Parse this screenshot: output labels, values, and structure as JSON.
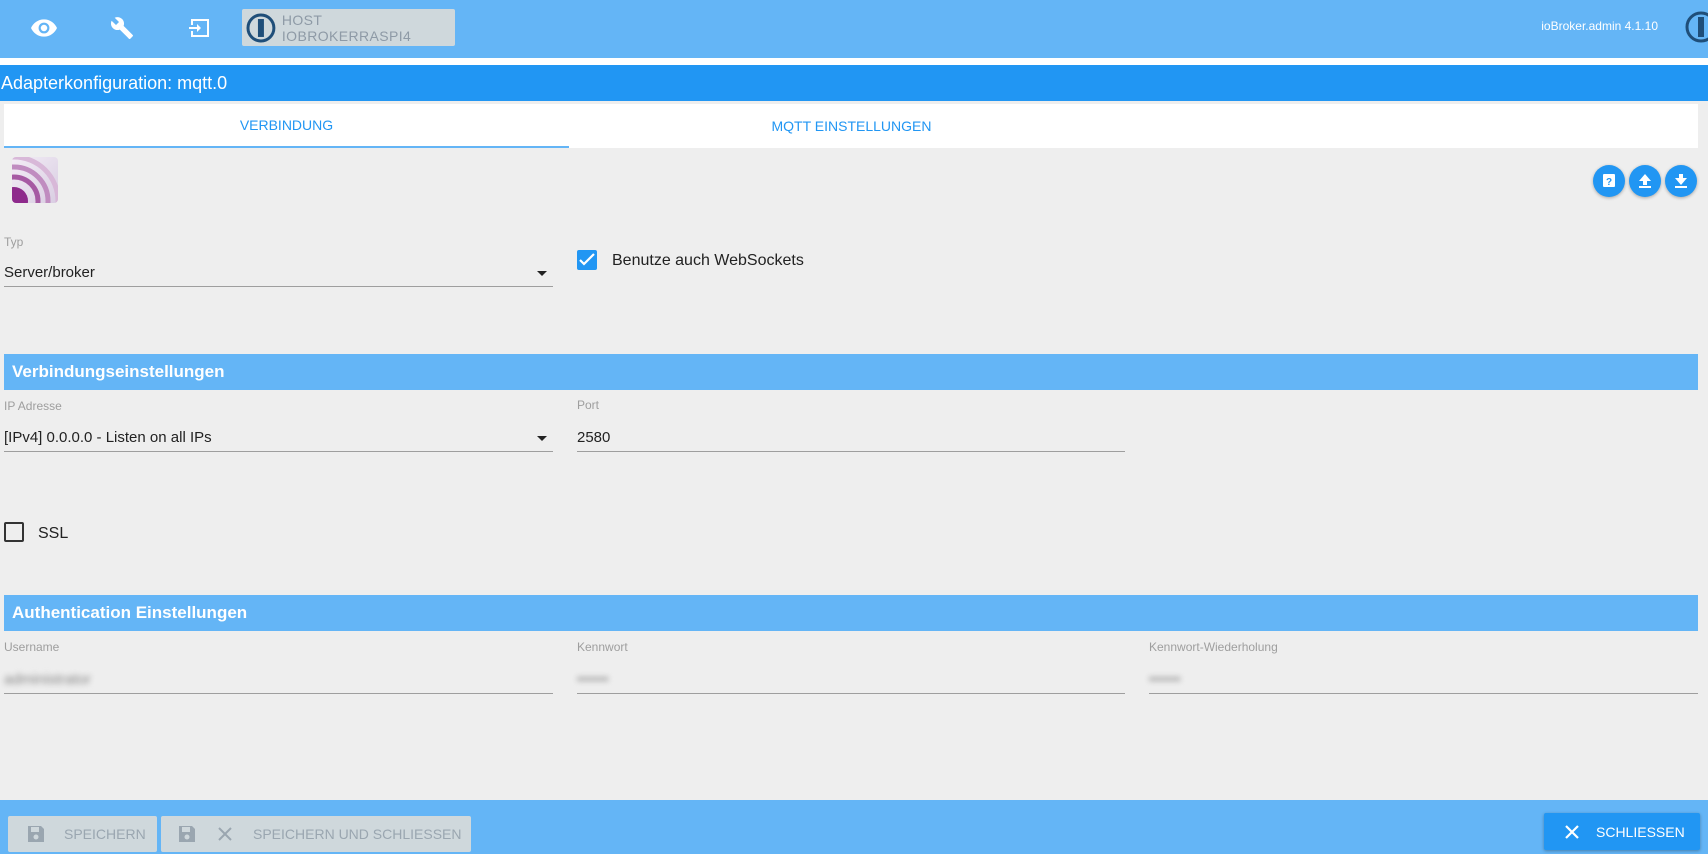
{
  "topbar": {
    "icons": [
      "eye-icon",
      "wrench-icon",
      "logout-icon"
    ],
    "host_label": "HOST IOBROKERRASPI4",
    "version": "ioBroker.admin 4.1.10"
  },
  "title": "Adapterkonfiguration: mqtt.0",
  "tabs": [
    {
      "label": "VERBINDUNG",
      "active": true
    },
    {
      "label": "MQTT EINSTELLUNGEN",
      "active": false
    }
  ],
  "form": {
    "typ_label": "Typ",
    "typ_value": "Server/broker",
    "websockets_label": "Benutze auch WebSockets",
    "websockets_checked": true
  },
  "sections": {
    "connection": "Verbindungseinstellungen",
    "auth": "Authentication Einstellungen"
  },
  "connection": {
    "ip_label": "IP Adresse",
    "ip_value": "[IPv4] 0.0.0.0 - Listen on all IPs",
    "port_label": "Port",
    "port_value": "2580",
    "ssl_label": "SSL",
    "ssl_checked": false
  },
  "auth": {
    "username_label": "Username",
    "username_value": "administrator",
    "password_label": "Kennwort",
    "password_value": "••••••",
    "password_repeat_label": "Kennwort-Wiederholung",
    "password_repeat_value": "••••••"
  },
  "footer": {
    "save_label": "SPEICHERN",
    "save_close_label": "SPEICHERN UND SCHLIESSEN",
    "close_label": "SCHLIESSEN"
  },
  "colors": {
    "topbar": "#64b5f6",
    "titlebar": "#2196f3",
    "accent": "#2196f3",
    "background": "#eeeeee"
  }
}
